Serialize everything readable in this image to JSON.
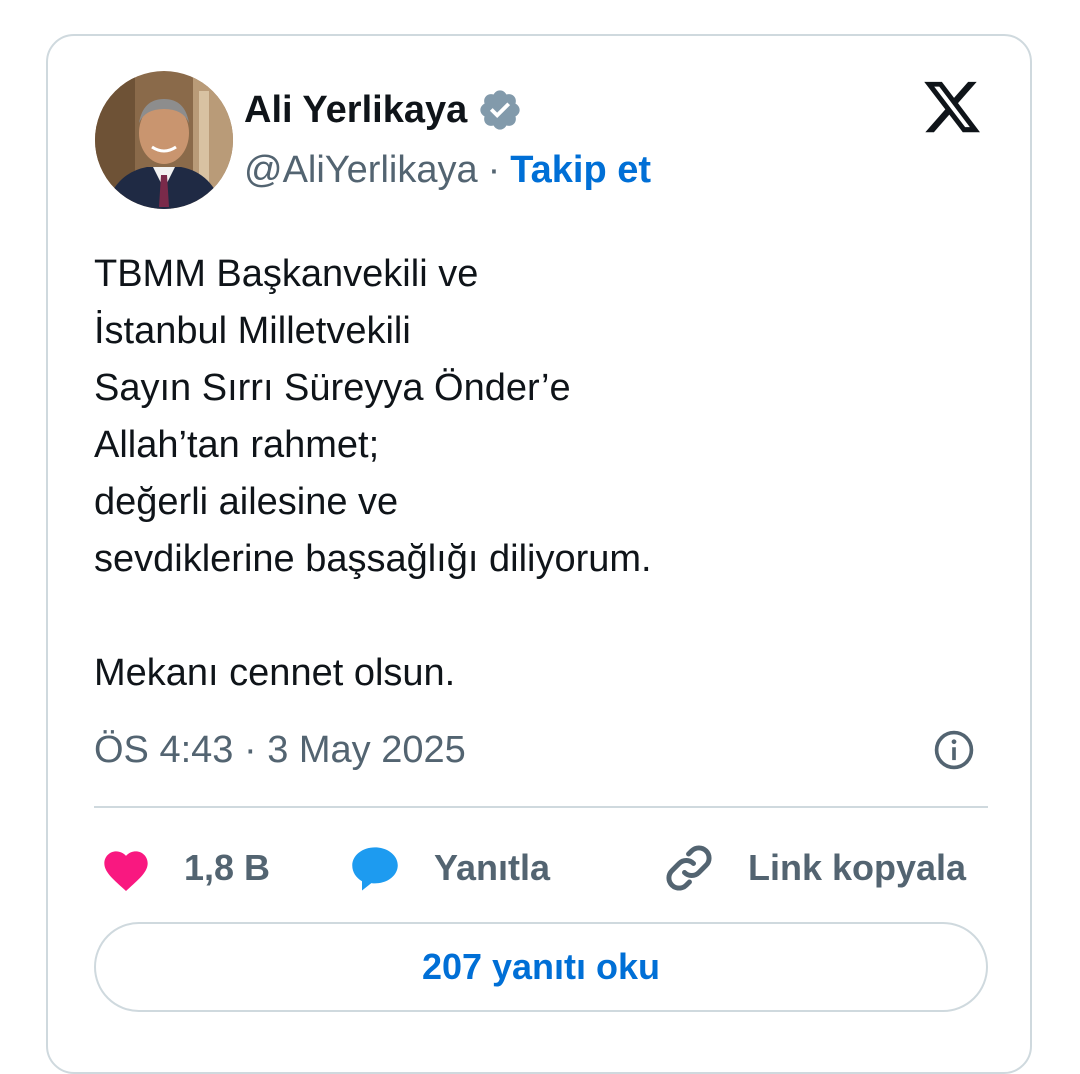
{
  "author": {
    "name": "Ali Yerlikaya",
    "handle": "@AliYerlikaya",
    "separator": "·",
    "follow_label": "Takip et",
    "verified_icon": "verified-badge-icon"
  },
  "tweet": {
    "lines": [
      "TBMM Başkanvekili ve",
      "İstanbul Milletvekili",
      "Sayın Sırrı Süreyya Önder’e",
      "Allah’tan rahmet;",
      "değerli ailesine ve",
      "sevdiklerine başsağlığı diliyorum.",
      "",
      "Mekanı cennet olsun."
    ],
    "timestamp": "ÖS 4:43 · 3 May 2025"
  },
  "actions": {
    "like_count": "1,8 B",
    "reply_label": "Yanıtla",
    "copy_link_label": "Link kopyala"
  },
  "read_replies_label": "207 yanıtı oku",
  "colors": {
    "accent": "#006fd6",
    "like": "#f91880",
    "reply": "#1d9bf0",
    "secondary_text": "#536471",
    "border": "#cfd9de"
  }
}
